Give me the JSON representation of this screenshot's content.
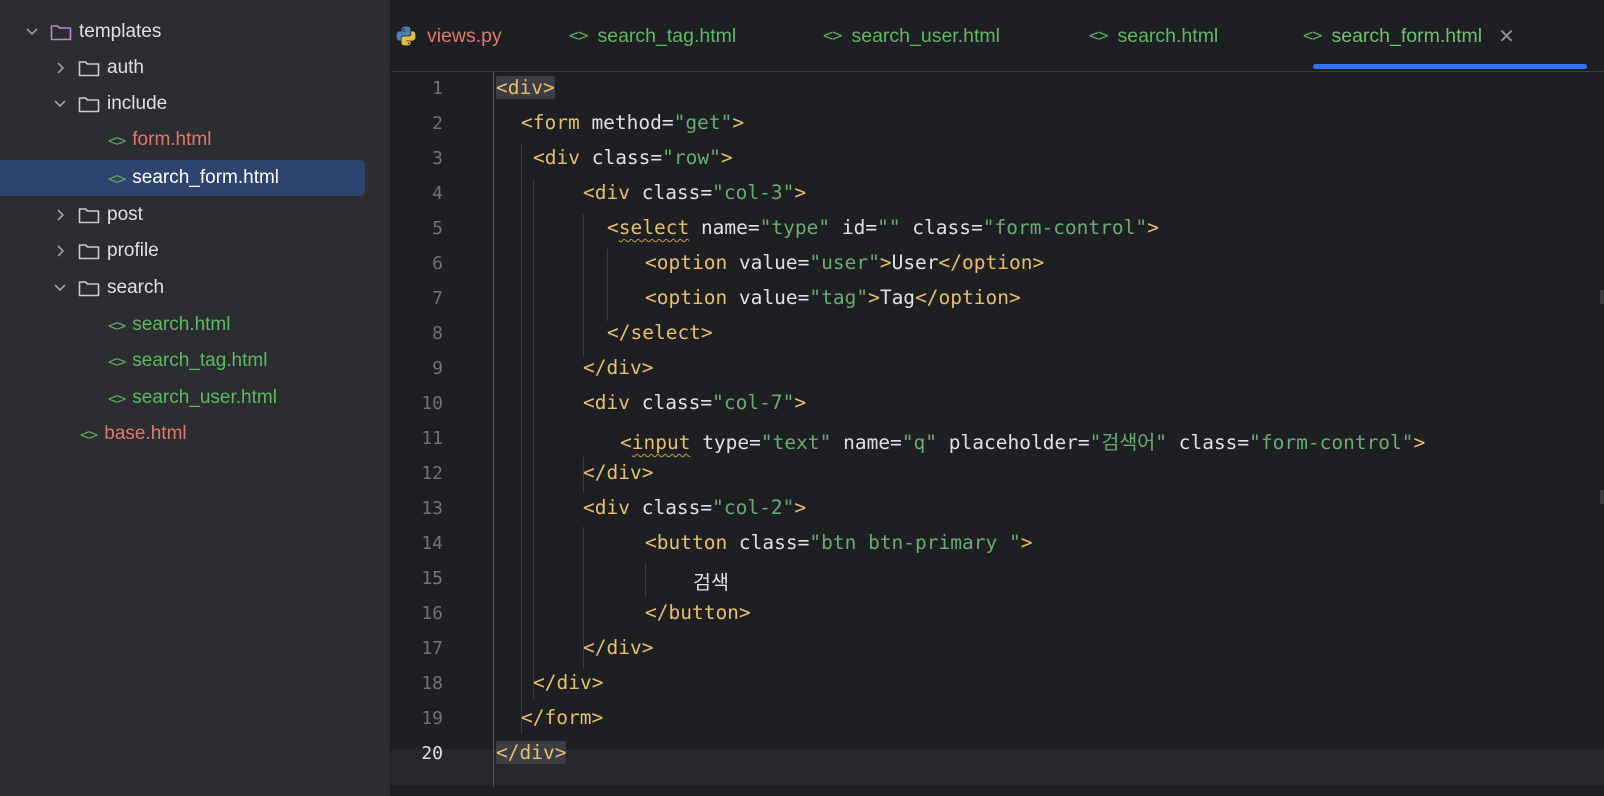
{
  "project_tree": {
    "items": [
      {
        "label": "templates",
        "kind": "folder",
        "expanded": true,
        "depth": 0
      },
      {
        "label": "auth",
        "kind": "folder",
        "expanded": false,
        "depth": 1
      },
      {
        "label": "include",
        "kind": "folder",
        "expanded": true,
        "depth": 1
      },
      {
        "label": "form.html",
        "kind": "file",
        "status": "modified",
        "depth": 2
      },
      {
        "label": "search_form.html",
        "kind": "file",
        "status": "new",
        "depth": 2,
        "selected": true
      },
      {
        "label": "post",
        "kind": "folder",
        "expanded": false,
        "depth": 1
      },
      {
        "label": "profile",
        "kind": "folder",
        "expanded": false,
        "depth": 1
      },
      {
        "label": "search",
        "kind": "folder",
        "expanded": true,
        "depth": 1
      },
      {
        "label": "search.html",
        "kind": "file",
        "status": "new",
        "depth": 2
      },
      {
        "label": "search_tag.html",
        "kind": "file",
        "status": "new",
        "depth": 2
      },
      {
        "label": "search_user.html",
        "kind": "file",
        "status": "new",
        "depth": 2
      },
      {
        "label": "base.html",
        "kind": "file",
        "status": "modified",
        "depth": 1
      }
    ]
  },
  "tabs": [
    {
      "label": "views.py",
      "icon": "python-icon",
      "status": "modified"
    },
    {
      "label": "search_tag.html",
      "icon": "html-icon",
      "status": "new"
    },
    {
      "label": "search_user.html",
      "icon": "html-icon",
      "status": "new"
    },
    {
      "label": "search.html",
      "icon": "html-icon",
      "status": "new"
    },
    {
      "label": "search_form.html",
      "icon": "html-icon",
      "status": "new",
      "active": true
    }
  ],
  "editor": {
    "current_line": 20,
    "lines": [
      {
        "n": "1"
      },
      {
        "n": "2"
      },
      {
        "n": "3"
      },
      {
        "n": "4"
      },
      {
        "n": "5"
      },
      {
        "n": "6"
      },
      {
        "n": "7"
      },
      {
        "n": "8"
      },
      {
        "n": "9"
      },
      {
        "n": "10"
      },
      {
        "n": "11"
      },
      {
        "n": "12"
      },
      {
        "n": "13"
      },
      {
        "n": "14"
      },
      {
        "n": "15"
      },
      {
        "n": "16"
      },
      {
        "n": "17"
      },
      {
        "n": "18"
      },
      {
        "n": "19"
      },
      {
        "n": "20"
      }
    ],
    "code": {
      "l1": [
        "<div>"
      ],
      "l2": [
        "<form",
        " method=",
        "\"get\"",
        ">"
      ],
      "l3": [
        "<div",
        " class=",
        "\"row\"",
        ">"
      ],
      "l4": [
        "<div",
        " class=",
        "\"col-3\"",
        ">"
      ],
      "l5": [
        "<",
        "select",
        " name=",
        "\"type\"",
        " id=",
        "\"\"",
        " class=",
        "\"form-control\"",
        ">"
      ],
      "l6": [
        "<option",
        " value=",
        "\"user\"",
        ">",
        "User",
        "</option>"
      ],
      "l7": [
        "<option",
        " value=",
        "\"tag\"",
        ">",
        "Tag",
        "</option>"
      ],
      "l8": [
        "</select>"
      ],
      "l9": [
        "</div>"
      ],
      "l10": [
        "<div",
        " class=",
        "\"col-7\"",
        ">"
      ],
      "l11": [
        "<",
        "input",
        " type=",
        "\"text\"",
        " name=",
        "\"q\"",
        " placeholder=",
        "\"검색어\"",
        " class=",
        "\"form-control\"",
        ">"
      ],
      "l12": [
        "</div>"
      ],
      "l13": [
        "<div",
        " class=",
        "\"col-2\"",
        ">"
      ],
      "l14": [
        "<button",
        " class=",
        "\"btn btn-primary \"",
        ">"
      ],
      "l15": [
        "검색"
      ],
      "l16": [
        "</button>"
      ],
      "l17": [
        "</div>"
      ],
      "l18": [
        "</div>"
      ],
      "l19": [
        "</form>"
      ],
      "l20": [
        "</div>"
      ]
    }
  },
  "colors": {
    "tag": "#e8bf6a",
    "string": "#6aab73",
    "modified_file": "#e1786c",
    "new_file": "#5fb865",
    "accent": "#3574f0"
  }
}
